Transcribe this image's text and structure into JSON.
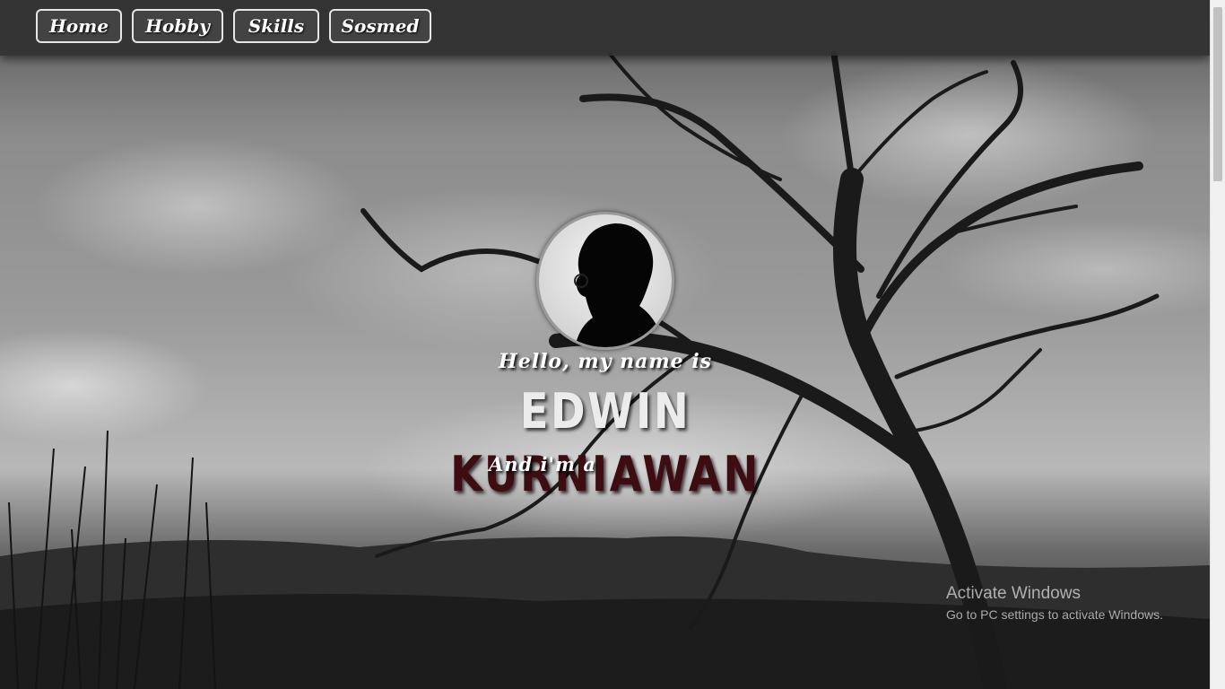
{
  "nav": {
    "items": [
      {
        "label": "Home"
      },
      {
        "label": "Hobby"
      },
      {
        "label": "Skills"
      },
      {
        "label": "Sosmed"
      }
    ]
  },
  "hero": {
    "greeting": "Hello, my name is",
    "first_name": "EDWIN",
    "last_name": "KURNIAWAN",
    "role_prefix": "And i'm a",
    "avatar_icon": "person-silhouette-icon"
  },
  "watermark": {
    "title": "Activate Windows",
    "subtitle": "Go to PC settings to activate Windows."
  },
  "colors": {
    "last_name": "#3e0d12",
    "first_name": "#ececec",
    "navbar": "#303030",
    "nav_border": "#e6e6e6"
  }
}
